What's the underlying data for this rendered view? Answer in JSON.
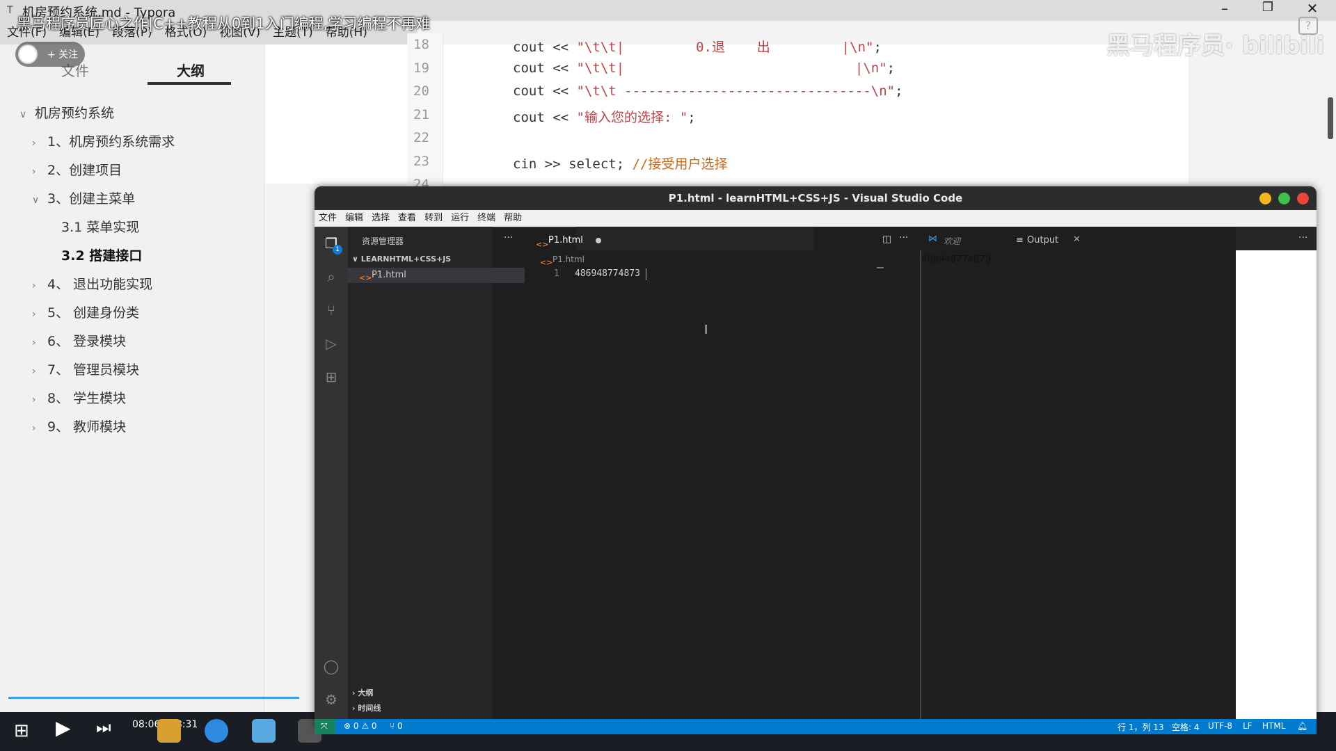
{
  "typora": {
    "window_title": "机房预约系统.md - Typora",
    "menu": [
      "文件(F)",
      "编辑(E)",
      "段落(P)",
      "格式(O)",
      "视图(V)",
      "主题(T)",
      "帮助(H)"
    ],
    "tabs": [
      "文件",
      "大纲"
    ],
    "outline": [
      {
        "label": "机房预约系统",
        "level": 0,
        "arrow": "∨"
      },
      {
        "label": "1、机房预约系统需求",
        "level": 1,
        "arrow": "›"
      },
      {
        "label": "2、创建项目",
        "level": 1,
        "arrow": "›"
      },
      {
        "label": "3、创建主菜单",
        "level": 1,
        "arrow": "∨"
      },
      {
        "label": "3.1 菜单实现",
        "level": 2,
        "arrow": ""
      },
      {
        "label": "3.2 搭建接口",
        "level": 2,
        "arrow": "",
        "active": true
      },
      {
        "label": "4、 退出功能实现",
        "level": 1,
        "arrow": "›"
      },
      {
        "label": "5、 创建身份类",
        "level": 1,
        "arrow": "›"
      },
      {
        "label": "6、 登录模块",
        "level": 1,
        "arrow": "›"
      },
      {
        "label": "7、 管理员模块",
        "level": 1,
        "arrow": "›"
      },
      {
        "label": "8、 学生模块",
        "level": 1,
        "arrow": "›"
      },
      {
        "label": "9、 教师模块",
        "level": 1,
        "arrow": "›"
      }
    ],
    "code": [
      {
        "n": "18",
        "text": "cout << \"\\t\\t|         0.退    出         |\\n\";"
      },
      {
        "n": "19",
        "text": "cout << \"\\t\\t|                             |\\n\";"
      },
      {
        "n": "20",
        "text": "cout << \"\\t\\t -------------------------------\\n\";"
      },
      {
        "n": "21",
        "text": "cout << \"输入您的选择: \";"
      },
      {
        "n": "22",
        "text": ""
      },
      {
        "n": "23",
        "text": "cin >> select; //接受用户选择"
      },
      {
        "n": "24",
        "text": ""
      }
    ]
  },
  "video": {
    "title": "黑马程序员匠心之作|C++教程从0到1入门编程,学习编程不再难",
    "follow_label": "+ 关注",
    "watermark": "黑马程序员· bilibili",
    "time": "08:06 / 08:31",
    "progress": 0.95
  },
  "vscode": {
    "title": "P1.html - learnHTML+CSS+JS - Visual Studio Code",
    "menu": [
      "文件",
      "编辑",
      "选择",
      "查看",
      "转到",
      "运行",
      "终端",
      "帮助"
    ],
    "explorer_title": "资源管理器",
    "folder": "LEARNHTML+CSS+JS",
    "file": "P1.html",
    "sections": [
      "大纲",
      "时间线"
    ],
    "tab": "P1.html",
    "breadcrumb": "P1.html",
    "line_number": "1",
    "line_text": "486948774873",
    "right_tabs": [
      "欢迎",
      "Output"
    ],
    "output_text": "486948774873",
    "status": {
      "problems": "⊗ 0 ⚠ 0",
      "ports": "⑂ 0",
      "position": "行 1，列 13",
      "spaces": "空格: 4",
      "encoding": "UTF-8",
      "eol": "LF",
      "language": "HTML"
    },
    "explorer_badge": "1"
  }
}
